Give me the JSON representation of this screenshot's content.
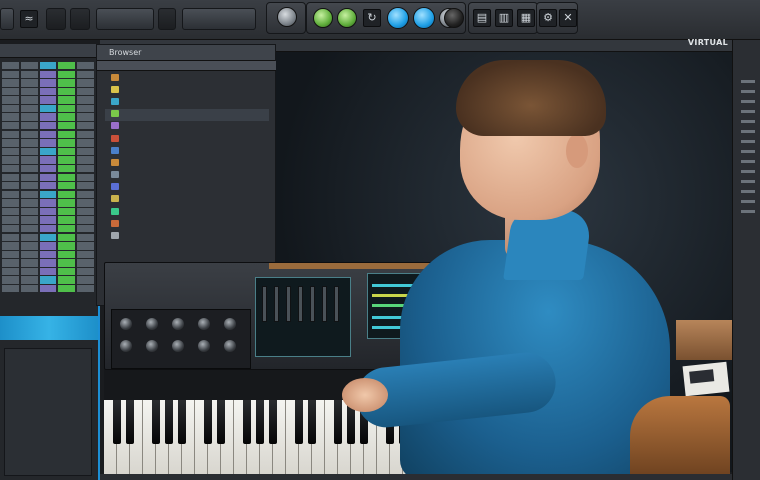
{
  "toolbar": {
    "left_icons": [
      "waveform-icon",
      "folder-icon",
      "grid-icon",
      "record-icon"
    ],
    "transport_icons": [
      "play-icon",
      "stop-icon",
      "loop-icon"
    ]
  },
  "browser": {
    "title": "Browser",
    "items": [
      "",
      "",
      "",
      "",
      "",
      "",
      "",
      "",
      "",
      "",
      "",
      "",
      "",
      ""
    ]
  },
  "viewport": {
    "title": "VIRTUAL"
  },
  "colors": {
    "accent": "#1c8fd6",
    "meter_green": "#4fbf4a",
    "meter_purple": "#7a6fb8",
    "shirt_blue": "#1b5f8e"
  }
}
